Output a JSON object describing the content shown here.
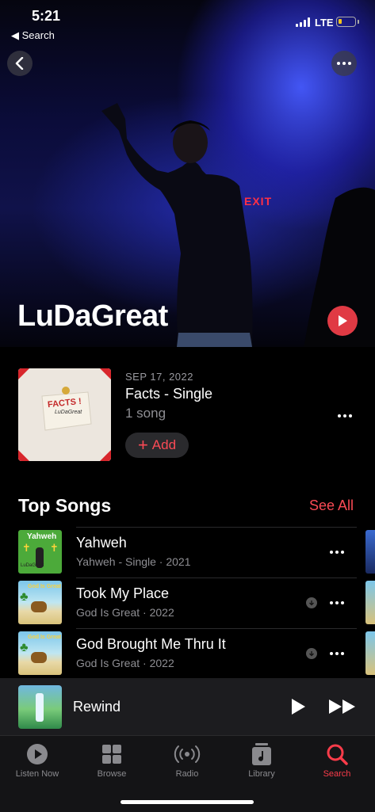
{
  "status": {
    "time": "5:21",
    "back_app": "◀ Search",
    "network": "LTE"
  },
  "artist": {
    "name": "LuDaGreat",
    "exit_sign": "EXIT"
  },
  "latest_release": {
    "date": "SEP 17, 2022",
    "title": "Facts - Single",
    "count": "1 song",
    "add_label": "Add",
    "cover_text": "FACTS !",
    "cover_sub": "LuDaGreat"
  },
  "top_songs": {
    "header": "Top Songs",
    "see_all": "See All",
    "items": [
      {
        "title": "Yahweh",
        "subtitle": "Yahweh - Single · 2021",
        "art_text": "Yahweh",
        "art_sub": "LuDaGreat"
      },
      {
        "title": "Took My Place",
        "subtitle": "God Is Great · 2022",
        "art_text": "God Is Great"
      },
      {
        "title": "God Brought Me Thru It",
        "subtitle": "God Is Great · 2022",
        "art_text": "God Is Great"
      }
    ]
  },
  "now_playing": {
    "title": "Rewind"
  },
  "tabs": [
    {
      "label": "Listen Now"
    },
    {
      "label": "Browse"
    },
    {
      "label": "Radio"
    },
    {
      "label": "Library"
    },
    {
      "label": "Search"
    }
  ],
  "colors": {
    "accent": "#fa3c4a",
    "background": "#000000"
  }
}
